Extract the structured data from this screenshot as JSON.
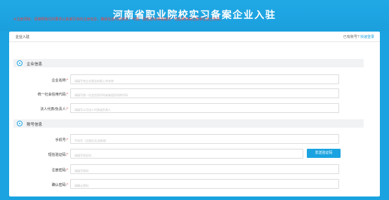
{
  "header": {
    "title": "河南省职业院校实习备案企业入驻"
  },
  "card": {
    "title": "企业入驻",
    "login_prompt": "已有账号?",
    "login_link": "快速登录"
  },
  "notice": "※注册须知：请按照我们的要求认真填写你的注册信息，确保信息内容真实、可靠。因信息有误造成的一切后果将由注册单位自己负责。",
  "sections": {
    "company": {
      "title": "企业信息"
    },
    "account": {
      "title": "账号信息"
    }
  },
  "fields": {
    "company_name": {
      "label": "企业名称:",
      "placeholder": "请填写完企业营业执照上的名称"
    },
    "credit_code": {
      "label": "统一社会信用代码:",
      "placeholder": "请填写统一社会信用代码或者组织机构代码"
    },
    "legal_rep": {
      "label": "法人代表/负责人:",
      "placeholder": "请填写公司法人代表或负责人"
    },
    "phone": {
      "label": "手机号:",
      "placeholder": "手机号（注册后无法修改）"
    },
    "sms_code": {
      "label": "短信验证码:",
      "placeholder": "请填写验证码"
    },
    "password": {
      "label": "注册密码:",
      "placeholder": "请填写密码"
    },
    "confirm_password": {
      "label": "确认密码:",
      "placeholder": "请确认密码"
    }
  },
  "buttons": {
    "send_code": "发送验证码"
  },
  "required_mark": "*",
  "colors": {
    "primary": "#1aa3e0",
    "required": "#e64340"
  }
}
